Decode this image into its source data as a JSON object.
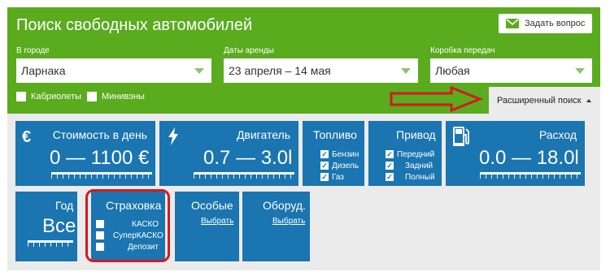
{
  "header": {
    "title": "Поиск свободных автомобилей",
    "ask_button": "Задать вопрос",
    "city": {
      "label": "В городе",
      "value": "Ларнака"
    },
    "dates": {
      "label": "Даты аренды",
      "value": "23 апреля – 14 мая"
    },
    "gearbox": {
      "label": "Коробка передач",
      "value": "Любая"
    },
    "checkboxes": [
      "Кабриолеты",
      "Минивэны"
    ],
    "advanced_button": "Расширенный поиск"
  },
  "filters": {
    "price": {
      "title": "Стоимость в день",
      "value": "0 — 1100 €"
    },
    "engine": {
      "title": "Двигатель",
      "value": "0.7 — 3.0l"
    },
    "fuel": {
      "title": "Топливо",
      "items": [
        "Бензин",
        "Дизель",
        "Газ"
      ]
    },
    "drive": {
      "title": "Привод",
      "items": [
        "Передний",
        "Задний",
        "Полный"
      ]
    },
    "consumption": {
      "title": "Расход",
      "value": "0.0 — 18.0l"
    },
    "year": {
      "title": "Год",
      "value": "Все"
    },
    "insurance": {
      "title": "Страховка",
      "items": [
        "КАСКО",
        "СуперКАСКО",
        "Депозит"
      ]
    },
    "special": {
      "title": "Особые",
      "link": "Выбрать"
    },
    "equipment": {
      "title": "Оборуд.",
      "link": "Выбрать"
    }
  },
  "colors": {
    "green": "#5aab1e",
    "tile_blue": "#1a75b0",
    "highlight_red": "#d6191f"
  }
}
